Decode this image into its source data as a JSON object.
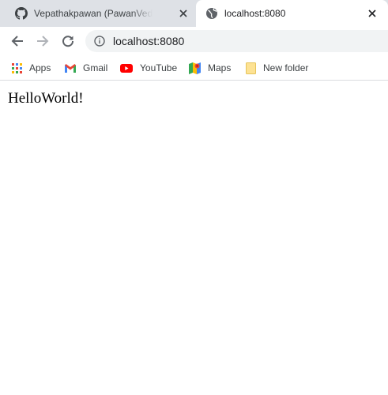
{
  "tabs": [
    {
      "title": "Vepathakpawan (PawanVedpathak)",
      "favicon": "github-icon",
      "active": false
    },
    {
      "title": "localhost:8080",
      "favicon": "globe-icon",
      "active": true
    }
  ],
  "toolbar": {
    "url": "localhost:8080",
    "back_icon": "back-arrow-icon",
    "forward_icon": "forward-arrow-icon",
    "reload_icon": "reload-icon",
    "site_info_icon": "info-icon"
  },
  "bookmarks": [
    {
      "label": "Apps",
      "icon": "apps-grid-icon"
    },
    {
      "label": "Gmail",
      "icon": "gmail-icon"
    },
    {
      "label": "YouTube",
      "icon": "youtube-icon"
    },
    {
      "label": "Maps",
      "icon": "maps-icon"
    },
    {
      "label": "New folder",
      "icon": "folder-icon"
    }
  ],
  "page": {
    "text": "HelloWorld!"
  },
  "colors": {
    "tabstrip_bg": "#dee1e6",
    "omnibox_bg": "#f1f3f4",
    "text_primary": "#202124",
    "youtube_red": "#ff0000",
    "folder_yellow": "#fde293"
  }
}
